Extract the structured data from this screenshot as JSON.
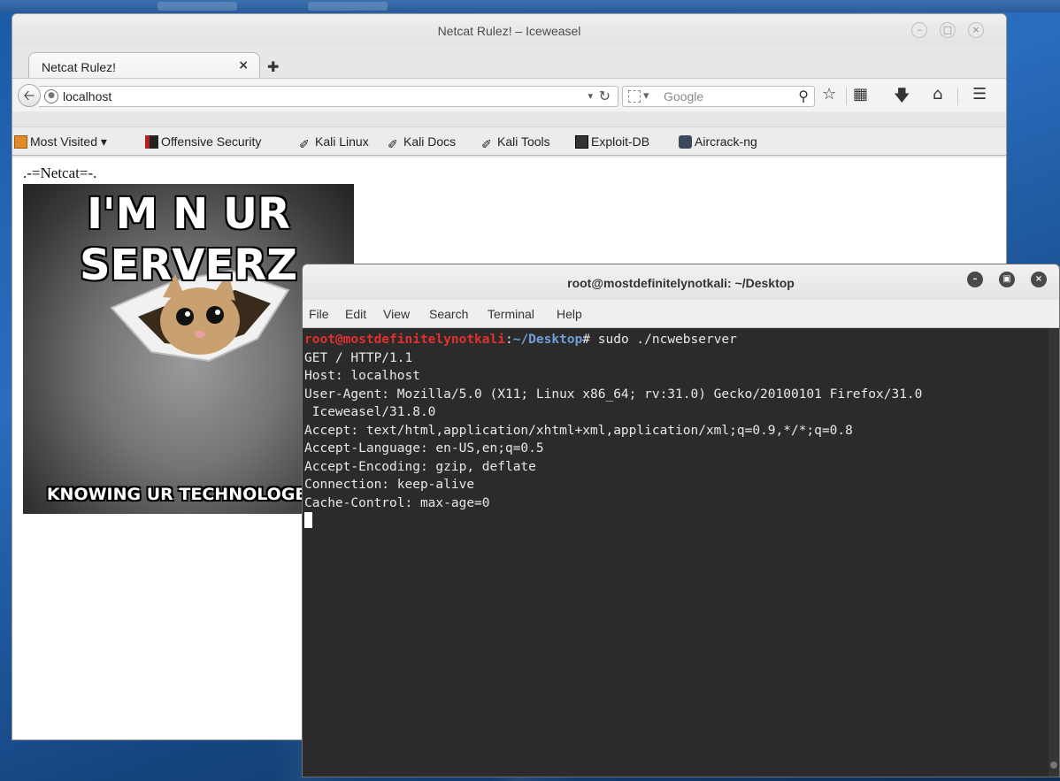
{
  "desktop": {
    "accent": "#1b5aa6"
  },
  "browser": {
    "window_title": "Netcat Rulez! – Iceweasel",
    "tab_label": "Netcat Rulez!",
    "tab_close": "×",
    "new_tab": "✚",
    "url": "localhost",
    "search_placeholder": "Google",
    "search_engine_arrow": "▾",
    "url_dropdown": "▾",
    "bookmarks": [
      {
        "label": "Most Visited ▾",
        "icon": "folder-icon"
      },
      {
        "label": "Offensive Security",
        "icon": "offsec-icon"
      },
      {
        "label": "Kali Linux",
        "icon": "kali-dragon-icon"
      },
      {
        "label": "Kali Docs",
        "icon": "kali-dragon-icon"
      },
      {
        "label": "Kali Tools",
        "icon": "kali-dragon-icon"
      },
      {
        "label": "Exploit-DB",
        "icon": "exploitdb-icon"
      },
      {
        "label": "Aircrack-ng",
        "icon": "aircrack-icon"
      }
    ],
    "page": {
      "heading": ".-=Netcat=-.",
      "meme_top_1": "I'M N UR",
      "meme_top_2": "SERVERZ",
      "meme_bottom": "KNOWING UR TECHNOLOGEEZ"
    }
  },
  "terminal": {
    "title": "root@mostdefinitelynotkali: ~/Desktop",
    "menu": [
      "File",
      "Edit",
      "View",
      "Search",
      "Terminal",
      "Help"
    ],
    "prompt_user": "root@mostdefinitelynotkali",
    "prompt_sep": ":",
    "prompt_path": "~/Desktop",
    "prompt_command": "# sudo ./ncwebserver",
    "lines": [
      "GET / HTTP/1.1",
      "Host: localhost",
      "User-Agent: Mozilla/5.0 (X11; Linux x86_64; rv:31.0) Gecko/20100101 Firefox/31.0",
      " Iceweasel/31.8.0",
      "Accept: text/html,application/xhtml+xml,application/xml;q=0.9,*/*;q=0.8",
      "Accept-Language: en-US,en;q=0.5",
      "Accept-Encoding: gzip, deflate",
      "Connection: keep-alive",
      "Cache-Control: max-age=0",
      ""
    ]
  }
}
